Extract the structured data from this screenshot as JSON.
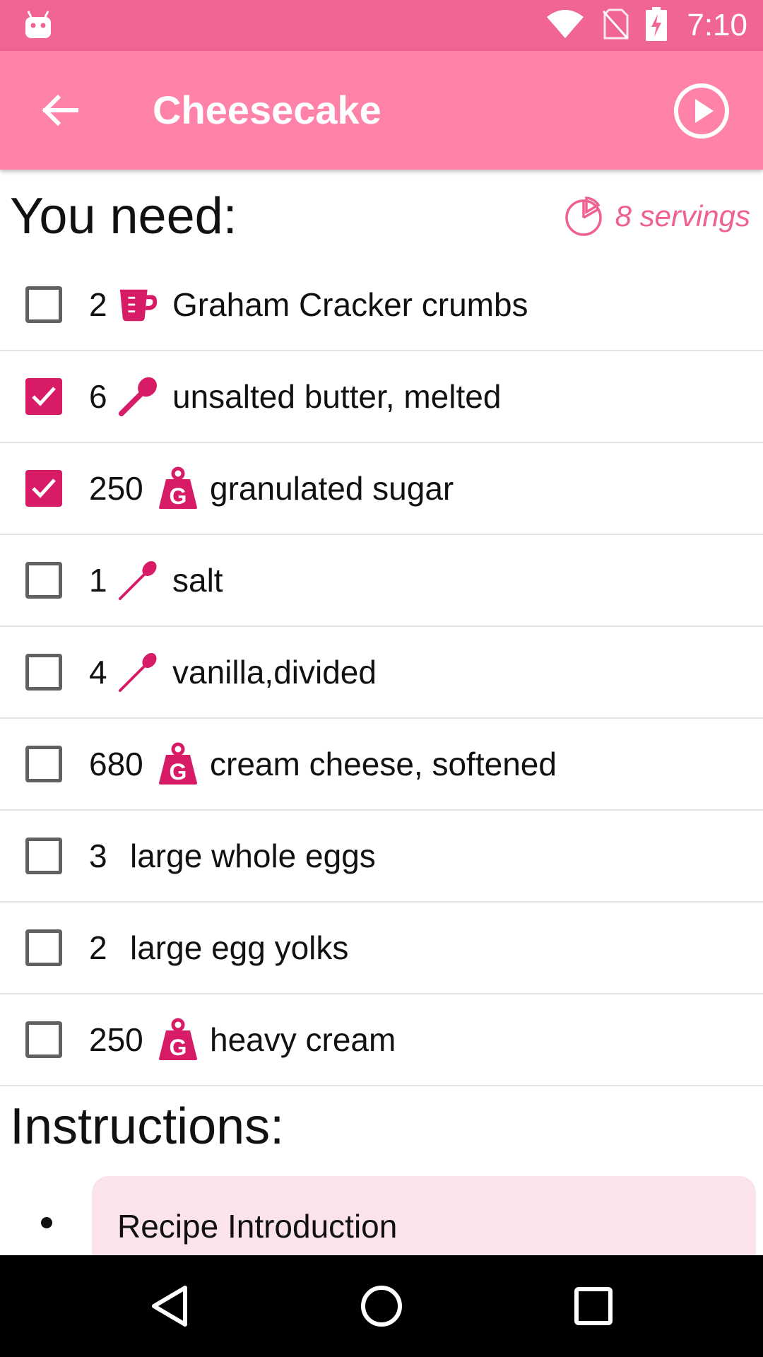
{
  "status_bar": {
    "time": "7:10",
    "icons": [
      "android-icon",
      "wifi-icon",
      "no-sim-icon",
      "battery-charging-icon"
    ]
  },
  "app_bar": {
    "title": "Cheesecake",
    "back_icon": "arrow-back-icon",
    "play_icon": "play-circle-icon"
  },
  "ingredients_section": {
    "heading": "You need:",
    "servings": "8 servings",
    "items": [
      {
        "checked": false,
        "qty": "2",
        "unit_icon": "cup-icon",
        "name": "Graham Cracker crumbs"
      },
      {
        "checked": true,
        "qty": "6",
        "unit_icon": "tablespoon-icon",
        "name": "unsalted butter, melted"
      },
      {
        "checked": true,
        "qty": "250",
        "unit_icon": "gram-weight-icon",
        "name": "granulated sugar"
      },
      {
        "checked": false,
        "qty": "1",
        "unit_icon": "teaspoon-icon",
        "name": "salt"
      },
      {
        "checked": false,
        "qty": "4",
        "unit_icon": "teaspoon-icon",
        "name": "vanilla,divided"
      },
      {
        "checked": false,
        "qty": "680",
        "unit_icon": "gram-weight-icon",
        "name": "cream cheese, softened"
      },
      {
        "checked": false,
        "qty": "3",
        "unit_icon": "",
        "name": "large whole eggs"
      },
      {
        "checked": false,
        "qty": "2",
        "unit_icon": "",
        "name": "large egg yolks"
      },
      {
        "checked": false,
        "qty": "250",
        "unit_icon": "gram-weight-icon",
        "name": "heavy cream"
      }
    ]
  },
  "instructions_section": {
    "heading": "Instructions:",
    "steps": [
      "Recipe Introduction"
    ]
  },
  "nav_bar": {
    "icons": [
      "nav-back-icon",
      "nav-home-icon",
      "nav-recents-icon"
    ]
  },
  "colors": {
    "status_bar": "#f06592",
    "app_bar": "#ff83a9",
    "accent": "#d81b67",
    "servings": "#ee6190",
    "step_card": "#fbe3ec"
  }
}
